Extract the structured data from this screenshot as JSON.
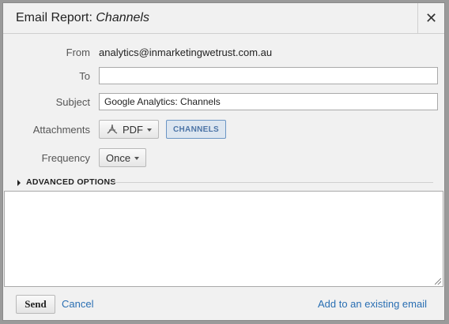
{
  "dialog": {
    "title_prefix": "Email Report: ",
    "title_italic": "Channels",
    "close_glyph": "✕"
  },
  "form": {
    "from_label": "From",
    "from_value": "analytics@inmarketingwetrust.com.au",
    "to_label": "To",
    "to_value": "",
    "subject_label": "Subject",
    "subject_value": "Google Analytics: Channels",
    "attachments_label": "Attachments",
    "attachment_format": "PDF",
    "attachment_chip": "CHANNELS",
    "frequency_label": "Frequency",
    "frequency_value": "Once"
  },
  "advanced": {
    "label": "ADVANCED OPTIONS"
  },
  "message": {
    "value": ""
  },
  "footer": {
    "send_label": "Send",
    "cancel_label": "Cancel",
    "add_existing_label": "Add to an existing email"
  },
  "colors": {
    "link": "#2a6fb3",
    "chip_border": "#6b95c4",
    "chip_text": "#4c74a6"
  },
  "icons": [
    "close-icon",
    "pdf-icon",
    "chevron-down-icon",
    "triangle-right-icon",
    "resize-handle-icon"
  ]
}
